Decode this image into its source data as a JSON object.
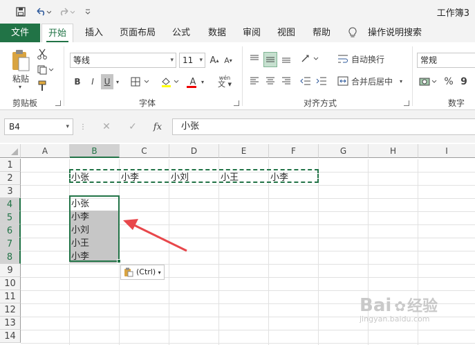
{
  "window": {
    "title": "工作簿3"
  },
  "quick_access": {
    "items": [
      "save-icon",
      "undo-icon",
      "redo-icon",
      "customize-icon"
    ]
  },
  "tabs": [
    "文件",
    "开始",
    "插入",
    "页面布局",
    "公式",
    "数据",
    "审阅",
    "视图",
    "帮助",
    "操作说明搜索"
  ],
  "ribbon": {
    "clipboard": {
      "paste_label": "粘贴",
      "group_label": "剪贴板"
    },
    "font": {
      "font_name": "等线",
      "font_size": "11",
      "bold": "B",
      "italic": "I",
      "underline": "U",
      "grow": "A",
      "shrink": "A",
      "font_color": "A",
      "phonetic": "wén",
      "group_label": "字体"
    },
    "alignment": {
      "wrap_text": "自动换行",
      "merge_center": "合并后居中",
      "group_label": "对齐方式"
    },
    "number": {
      "format": "常规",
      "percent": "%",
      "comma": "9",
      "group_label": "数字"
    }
  },
  "formula_bar": {
    "name_box": "B4",
    "cancel": "✕",
    "enter": "✓",
    "fx": "fx",
    "value": "小张"
  },
  "sheet": {
    "columns": [
      "A",
      "B",
      "C",
      "D",
      "E",
      "F",
      "G",
      "H",
      "I"
    ],
    "rows": [
      "1",
      "2",
      "3",
      "4",
      "5",
      "6",
      "7",
      "8",
      "9",
      "10",
      "11",
      "12",
      "13",
      "14"
    ],
    "row2": [
      "小张",
      "小李",
      "小刘",
      "小王",
      "小李"
    ],
    "colB": [
      "小张",
      "小李",
      "小刘",
      "小王",
      "小李"
    ],
    "paste_options": "(Ctrl)"
  },
  "watermark": {
    "text": "Bai",
    "text2": "经验",
    "url": "jingyan.baidu.com"
  },
  "colors": {
    "accent": "#217346",
    "arrow": "#e8474b"
  }
}
